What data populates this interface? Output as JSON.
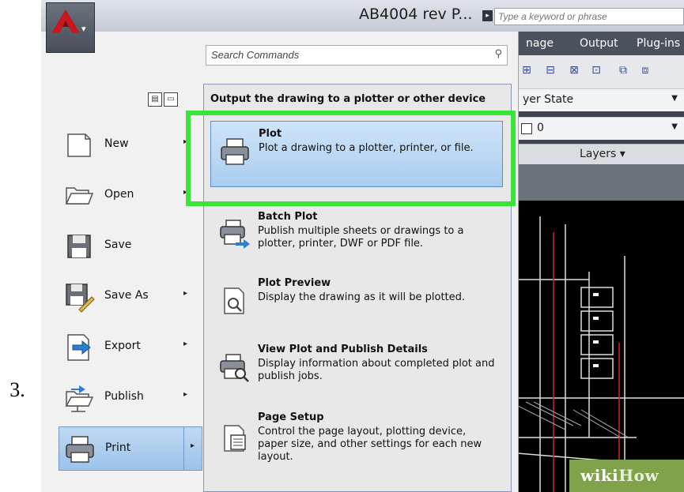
{
  "step_number": "3.",
  "titlebar": {
    "title": "AB4004 rev P...",
    "search_placeholder": "Type a keyword or phrase"
  },
  "ribbon": {
    "tabs": [
      "nage",
      "Output",
      "Plug-ins"
    ],
    "layer_state": "yer State",
    "layer_value": "0",
    "layers_label": "Layers ▾"
  },
  "app_menu": {
    "search_placeholder": "Search Commands",
    "left_items": [
      {
        "label": "New",
        "submenu": "▸"
      },
      {
        "label": "Open",
        "submenu": "▸"
      },
      {
        "label": "Save",
        "submenu": ""
      },
      {
        "label": "Save As",
        "submenu": "▸"
      },
      {
        "label": "Export",
        "submenu": "▸"
      },
      {
        "label": "Publish",
        "submenu": "▸"
      },
      {
        "label": "Print",
        "submenu": "▸"
      }
    ],
    "panel": {
      "title": "Output the drawing to a plotter or other device",
      "items": [
        {
          "title": "Plot",
          "description": "Plot a drawing to a plotter, printer, or file."
        },
        {
          "title": "Batch Plot",
          "description": "Publish multiple sheets or drawings to a plotter, printer, DWF or PDF file."
        },
        {
          "title": "Plot Preview",
          "description": "Display the drawing as it will be plotted."
        },
        {
          "title": "View Plot and Publish Details",
          "description": "Display information about completed plot and publish jobs."
        },
        {
          "title": "Page Setup",
          "description": "Control the page layout, plotting device, paper size, and other settings for each new layout."
        }
      ]
    }
  },
  "watermark": {
    "wiki": "wiki",
    "how": "How"
  },
  "colors": {
    "highlight": "#39e53a",
    "accent_red": "#c8181e"
  }
}
